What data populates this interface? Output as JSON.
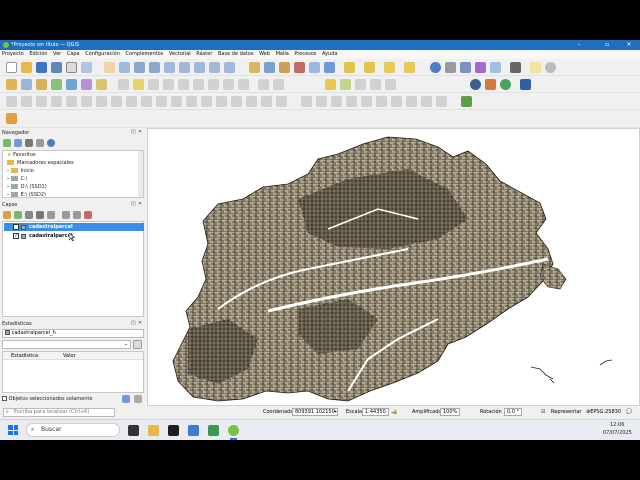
{
  "window": {
    "title": "*Proyecto sin título — QGIS"
  },
  "menu": [
    "Proyecto",
    "Edición",
    "Ver",
    "Capa",
    "Configuración",
    "Complementos",
    "Vectorial",
    "Ráster",
    "Base de datos",
    "Web",
    "Malla",
    "Procesos",
    "Ayuda"
  ],
  "navigator": {
    "title": "Navegador",
    "items": [
      "Favoritos",
      "Marcadores espaciales",
      "Inicio",
      "C:\\",
      "D:\\ (SSD1)",
      "E:\\ (SSD2)"
    ]
  },
  "layers": {
    "title": "Capas",
    "items": [
      {
        "name": "cadastralparcel",
        "checked": "✓",
        "selected": true
      },
      {
        "name": "cadastralparcel",
        "checked": "✓",
        "selected": false
      }
    ]
  },
  "statistics": {
    "title": "Estadísticas",
    "layer": "cadastralparcel_h",
    "col_stat": "Estadística",
    "col_value": "Valor",
    "selected_only": "Objetos seleccionados solamente"
  },
  "locator": {
    "placeholder": "Escriba para localizar (Ctrl+K)"
  },
  "status": {
    "coord_label": "Coordenada",
    "coord_value": "809391  102150",
    "scale_label": "Escala",
    "scale_value": "1:44350",
    "magnifier_label": "Amplificador",
    "magnifier_value": "100%",
    "rotation_label": "Rotación",
    "rotation_value": "0,0 °",
    "render_label": "Representar",
    "crs": "EPSG:25830"
  },
  "taskbar": {
    "search": "Buscar",
    "time": "12:06",
    "date": "07/07/2025"
  },
  "colors": {
    "parcel_fill": "#b2a891",
    "accent": "#1e6fc0"
  }
}
